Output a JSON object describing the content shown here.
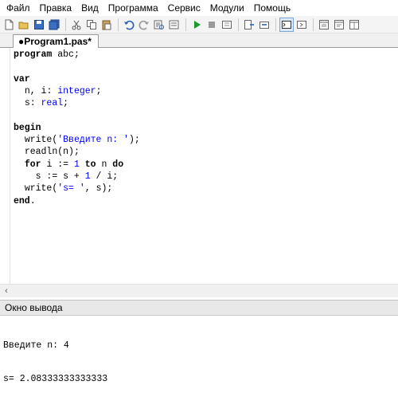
{
  "menu": [
    "Файл",
    "Правка",
    "Вид",
    "Программа",
    "Сервис",
    "Модули",
    "Помощь"
  ],
  "toolbar": {
    "icons": [
      "new-file-icon",
      "open-folder-icon",
      "save-icon",
      "save-all-icon",
      "cut-icon",
      "copy-icon",
      "paste-icon",
      "undo-icon",
      "redo-icon",
      "find-replace-icon",
      "goto-icon",
      "run-icon",
      "stop-icon",
      "compile-icon",
      "step-into-icon",
      "step-over-icon",
      "output-window-icon",
      "terminal-icon",
      "window-icon",
      "window2-icon",
      "window3-icon"
    ]
  },
  "tab": {
    "label": "●Program1.pas*"
  },
  "code": {
    "lines": [
      [
        "program abc;"
      ],
      [
        ""
      ],
      [
        "var"
      ],
      [
        "  n, i: integer;"
      ],
      [
        "  s: real;"
      ],
      [
        ""
      ],
      [
        "begin"
      ],
      [
        "  write('Введите n: ');"
      ],
      [
        "  readln(n);"
      ],
      [
        "  for i := 1 to n do"
      ],
      [
        "    s := s + 1 / i;"
      ],
      [
        "  write('s= ', s);"
      ],
      [
        "end."
      ]
    ]
  },
  "output": {
    "title": "Окно вывода",
    "lines": [
      "Введите n: 4",
      "s= 2.08333333333333"
    ]
  },
  "colors": {
    "keyword": "#000000",
    "type": "#0000ff",
    "string": "#0000ff",
    "number": "#0000ff"
  }
}
